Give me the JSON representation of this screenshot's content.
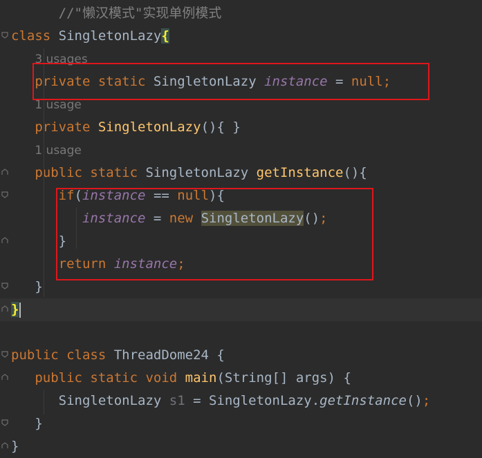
{
  "editor": {
    "lines": [
      {
        "tokens": [
          {
            "t": "      //\"懒汉模式\"实现单例模式",
            "c": "cm"
          }
        ]
      },
      {
        "tokens": [
          {
            "t": "class ",
            "c": "kw"
          },
          {
            "t": "SingletonLazy"
          },
          {
            "t": "{",
            "c": "hl-brace"
          }
        ]
      },
      {
        "hint": "3 usages",
        "indent": "   "
      },
      {
        "tokens": [
          {
            "t": "   "
          },
          {
            "t": "private static ",
            "c": "kw"
          },
          {
            "t": "SingletonLazy "
          },
          {
            "t": "instance",
            "c": "fld"
          },
          {
            "t": " = "
          },
          {
            "t": "null",
            "c": "kw"
          },
          {
            "t": ";",
            "c": "kw"
          }
        ]
      },
      {
        "hint": "1 usage",
        "indent": "   "
      },
      {
        "tokens": [
          {
            "t": "   "
          },
          {
            "t": "private ",
            "c": "kw"
          },
          {
            "t": "SingletonLazy",
            "c": "fn"
          },
          {
            "t": "(){ }"
          }
        ]
      },
      {
        "hint": "1 usage",
        "indent": "   "
      },
      {
        "tokens": [
          {
            "t": "   "
          },
          {
            "t": "public static ",
            "c": "kw"
          },
          {
            "t": "SingletonLazy "
          },
          {
            "t": "getInstance",
            "c": "fn"
          },
          {
            "t": "(){"
          }
        ]
      },
      {
        "tokens": [
          {
            "t": "      "
          },
          {
            "t": "if",
            "c": "kw"
          },
          {
            "t": "("
          },
          {
            "t": "instance",
            "c": "fld"
          },
          {
            "t": " == "
          },
          {
            "t": "null",
            "c": "kw"
          },
          {
            "t": "){"
          }
        ]
      },
      {
        "tokens": [
          {
            "t": "         "
          },
          {
            "t": "instance",
            "c": "fld"
          },
          {
            "t": " = "
          },
          {
            "t": "new ",
            "c": "kw"
          },
          {
            "t": "SingletonLazy",
            "c": "hl-ref"
          },
          {
            "t": "()"
          },
          {
            "t": ";",
            "c": "kw"
          }
        ]
      },
      {
        "tokens": [
          {
            "t": "      }"
          }
        ]
      },
      {
        "tokens": [
          {
            "t": "      "
          },
          {
            "t": "return ",
            "c": "kw"
          },
          {
            "t": "instance",
            "c": "fld"
          },
          {
            "t": ";",
            "c": "kw"
          }
        ]
      },
      {
        "tokens": [
          {
            "t": "   }"
          }
        ]
      },
      {
        "tokens": [
          {
            "t": "}",
            "c": "hl-brace"
          }
        ],
        "current": true,
        "caret": true
      },
      {
        "tokens": []
      },
      {
        "tokens": [
          {
            "t": "public class ",
            "c": "kw"
          },
          {
            "t": "ThreadDome24 {"
          }
        ]
      },
      {
        "tokens": [
          {
            "t": "   "
          },
          {
            "t": "public static void ",
            "c": "kw"
          },
          {
            "t": "main",
            "c": "fn"
          },
          {
            "t": "(String[] args) {"
          }
        ]
      },
      {
        "tokens": [
          {
            "t": "      SingletonLazy "
          },
          {
            "t": "s1",
            "c": "unused"
          },
          {
            "t": " = SingletonLazy."
          },
          {
            "t": "getInstance",
            "c": "sm"
          },
          {
            "t": "()"
          },
          {
            "t": ";",
            "c": "kw"
          }
        ]
      },
      {
        "tokens": [
          {
            "t": "   }"
          }
        ]
      },
      {
        "tokens": [
          {
            "t": "}"
          }
        ]
      }
    ]
  },
  "colors": {
    "background": "#2b2b2b",
    "keyword": "#cc7832",
    "field": "#9876aa",
    "method": "#ffc66d",
    "comment": "#808080",
    "annotation_box": "#e0161b"
  }
}
